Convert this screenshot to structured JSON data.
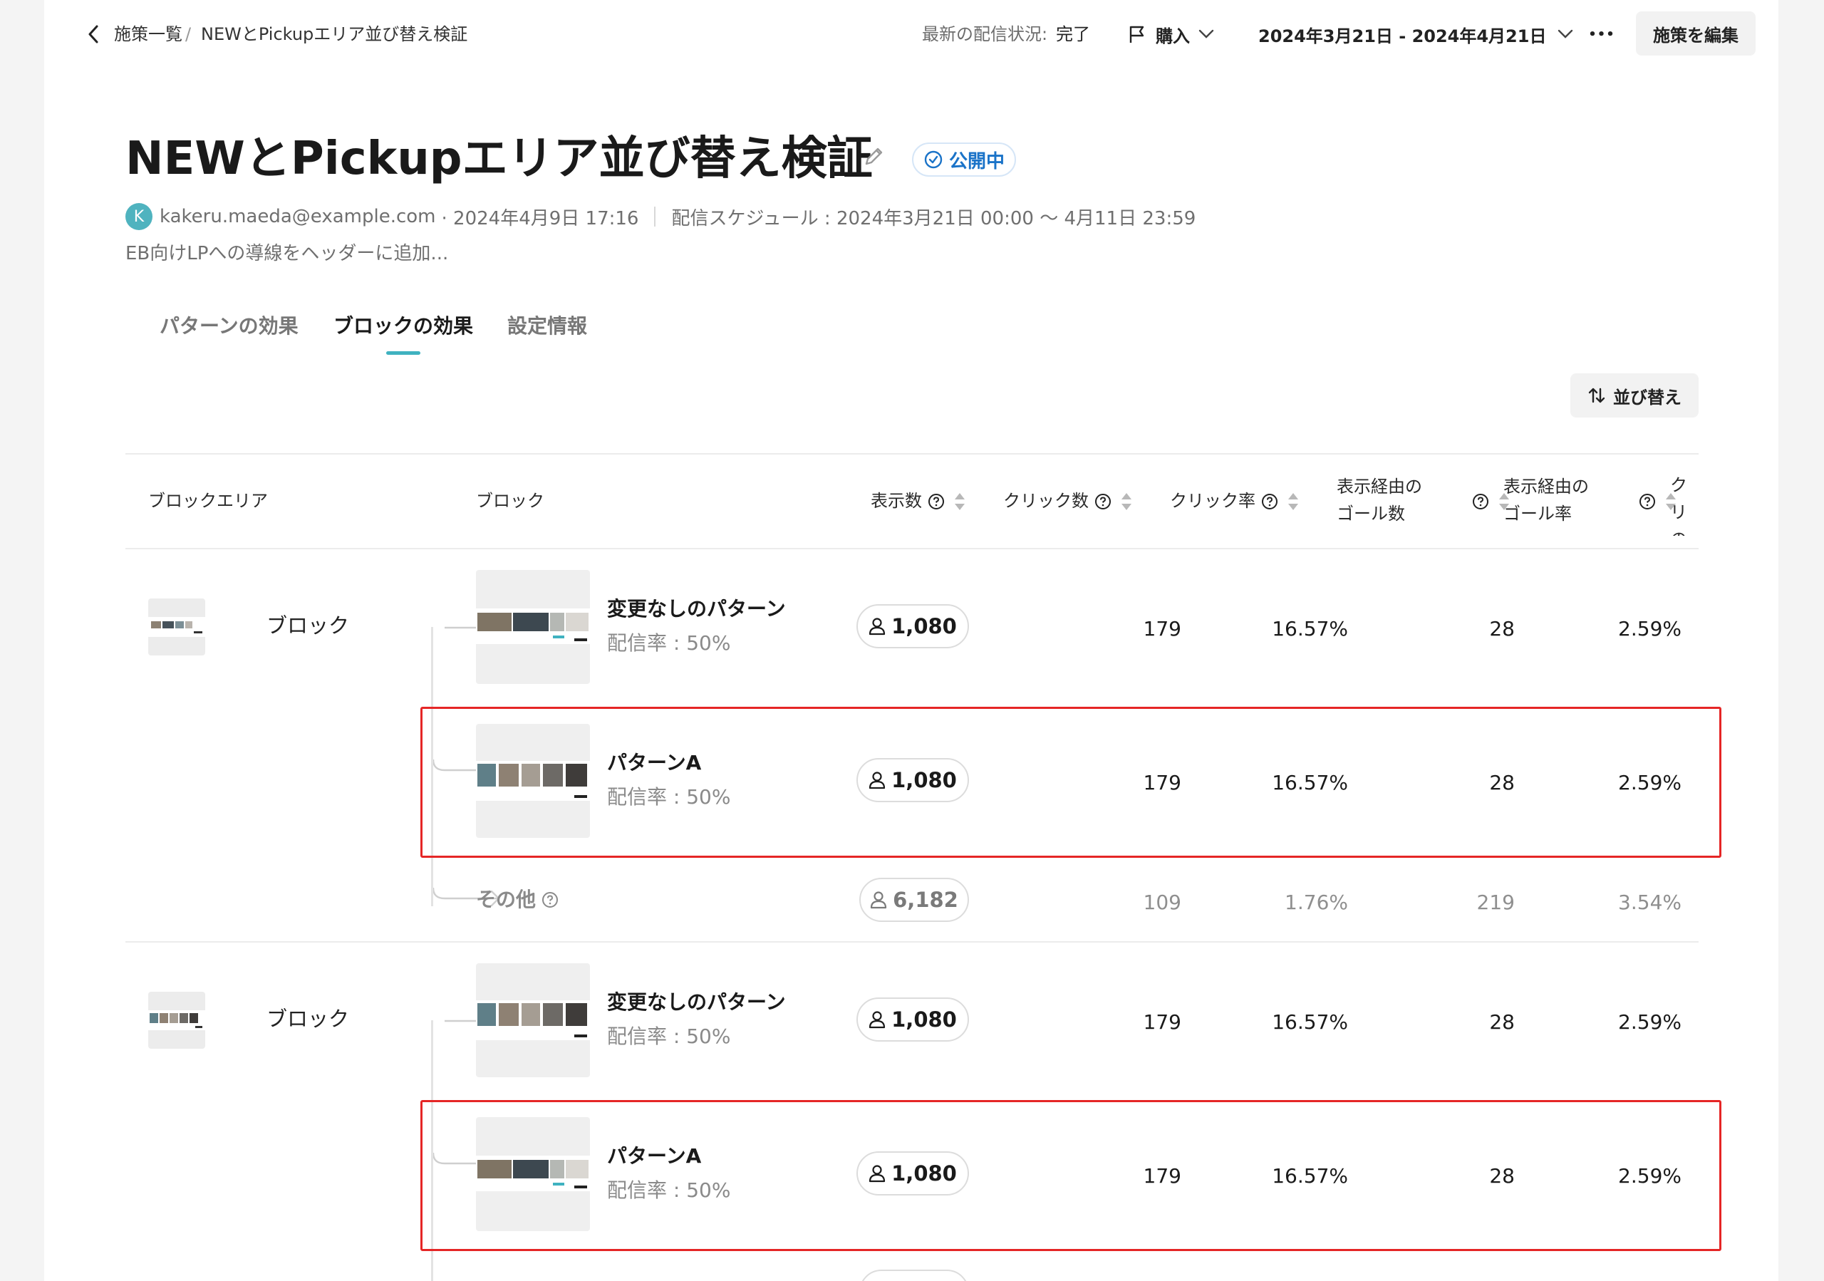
{
  "header": {
    "breadcrumb": [
      "施策一覧",
      "/",
      "NEWとPickupエリア並び替え検証"
    ],
    "status_label": "最新の配信状況:",
    "status_value": "完了",
    "goal_label": "購入",
    "date_range": "2024年3月21日 - 2024年4月21日",
    "more": "•••",
    "edit_button": "施策を編集"
  },
  "campaign": {
    "title": "NEWとPickupエリア並び替え検証",
    "status_badge": "公開中",
    "avatar_initial": "K",
    "author": "kakeru.maeda@example.com",
    "created": "· 2024年4月9日 17:16",
    "schedule": "配信スケジュール : 2024年3月21日 00:00 〜 4月11日 23:59",
    "description": "EB向けLPへの導線をヘッダーに追加..."
  },
  "tabs": [
    {
      "label": "パターンの効果",
      "active": false
    },
    {
      "label": "ブロックの効果",
      "active": true
    },
    {
      "label": "設定情報",
      "active": false
    }
  ],
  "sort_button": "並び替え",
  "table": {
    "headers": {
      "area": "ブロックエリア",
      "block": "ブロック",
      "impressions": "表示数",
      "clicks": "クリック数",
      "ctr": "クリック率",
      "goals_line1": "表示経由の",
      "goals_line2": "ゴール数",
      "goal_rate_line1": "表示経由の",
      "goal_rate_line2": "ゴール率",
      "trunc_line1": "クリ",
      "trunc_line2": "のゴ"
    },
    "groups": [
      {
        "area_label": "ブロック",
        "rows": [
          {
            "name": "変更なしのパターン",
            "rate": "配信率 : 50%",
            "impressions": "1,080",
            "clicks": "179",
            "ctr": "16.57%",
            "goals": "28",
            "goal_rate": "2.59%"
          },
          {
            "name": "パターンA",
            "rate": "配信率 : 50%",
            "impressions": "1,080",
            "clicks": "179",
            "ctr": "16.57%",
            "goals": "28",
            "goal_rate": "2.59%"
          }
        ],
        "other": {
          "name": "その他",
          "impressions": "6,182",
          "clicks": "109",
          "ctr": "1.76%",
          "goals": "219",
          "goal_rate": "3.54%"
        }
      },
      {
        "area_label": "ブロック",
        "rows": [
          {
            "name": "変更なしのパターン",
            "rate": "配信率 : 50%",
            "impressions": "1,080",
            "clicks": "179",
            "ctr": "16.57%",
            "goals": "28",
            "goal_rate": "2.59%"
          },
          {
            "name": "パターンA",
            "rate": "配信率 : 50%",
            "impressions": "1,080",
            "clicks": "179",
            "ctr": "16.57%",
            "goals": "28",
            "goal_rate": "2.59%"
          }
        ]
      }
    ]
  },
  "colors": {
    "accent": "#3fb2c0",
    "badge_blue": "#1a73c8",
    "highlight_red": "#e52626"
  }
}
